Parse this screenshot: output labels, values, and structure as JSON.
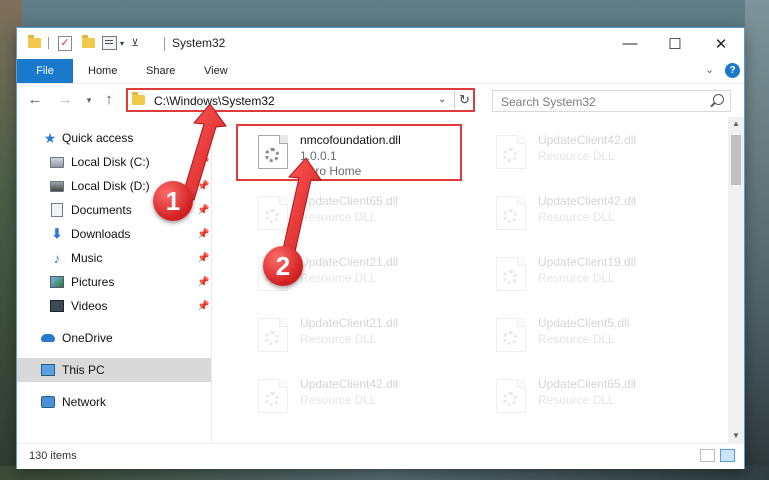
{
  "window": {
    "title": "System32",
    "controls": {
      "minimize": "—",
      "maximize": "☐",
      "close": "✕"
    }
  },
  "ribbon": {
    "tabs": [
      "File",
      "Home",
      "Share",
      "View"
    ],
    "help": "?"
  },
  "navigation": {
    "address": "C:\\Windows\\System32",
    "search_placeholder": "Search System32"
  },
  "sidebar": {
    "quick_access": "Quick access",
    "items": [
      {
        "label": "Local Disk (C:)",
        "icon": "drive-icon"
      },
      {
        "label": "Local Disk (D:)",
        "icon": "drive-icon"
      },
      {
        "label": "Documents",
        "icon": "documents-icon"
      },
      {
        "label": "Downloads",
        "icon": "downloads-icon"
      },
      {
        "label": "Music",
        "icon": "music-icon"
      },
      {
        "label": "Pictures",
        "icon": "pictures-icon"
      },
      {
        "label": "Videos",
        "icon": "videos-icon"
      }
    ],
    "onedrive": "OneDrive",
    "this_pc": "This PC",
    "network": "Network"
  },
  "files": [
    {
      "name": "nmcofoundation.dll",
      "line2": "1.0.0.1",
      "line3": "Nero Home"
    },
    {
      "name": "UpdateClient42.dll",
      "line2": "Resource DLL"
    },
    {
      "name": "UpdateClient65.dll",
      "line2": "Resource DLL"
    },
    {
      "name": "UpdateClient42.dll",
      "line2": "Resource DLL"
    },
    {
      "name": "UpdateClient21.dll",
      "line2": "Resource DLL"
    },
    {
      "name": "UpdateClient19.dll",
      "line2": "Resource DLL"
    },
    {
      "name": "UpdateClient21.dll",
      "line2": "Resource DLL"
    },
    {
      "name": "UpdateClient5.dll",
      "line2": "Resource DLL"
    },
    {
      "name": "UpdateClient42.dll",
      "line2": "Resource DLL"
    },
    {
      "name": "UpdateClient65.dll",
      "line2": "Resource DLL"
    }
  ],
  "status": {
    "items_count": "130 items"
  },
  "annotations": {
    "step1": "1",
    "step2": "2"
  },
  "colors": {
    "accent": "#1979ca",
    "highlight": "#e03b3b",
    "selected": "#d9d9d9"
  }
}
